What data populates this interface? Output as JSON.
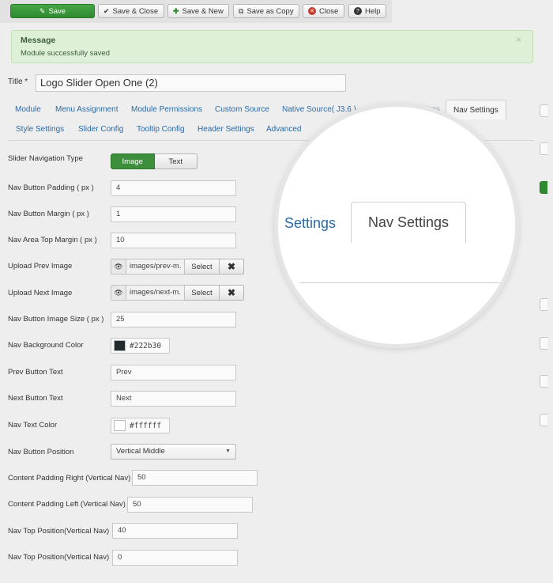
{
  "toolbar": {
    "save": "Save",
    "save_close": "Save & Close",
    "save_new": "Save & New",
    "save_copy": "Save as Copy",
    "close": "Close",
    "help": "Help"
  },
  "message": {
    "title": "Message",
    "text": "Module successfully saved"
  },
  "title_field": {
    "label": "Title *",
    "value": "Logo Slider Open One (2)"
  },
  "tabs": {
    "row1": [
      "Module",
      "Menu Assignment",
      "Module Permissions",
      "Custom Source",
      "Native Source( J3.6 )",
      "Responsive Settings",
      "Nav Settings"
    ],
    "row2": [
      "Style Settings",
      "Slider Config",
      "Tooltip Config",
      "Header Settings",
      "Advanced"
    ]
  },
  "magnifier": {
    "tab_left": "Settings",
    "tab_active": "Nav Settings"
  },
  "form": {
    "nav_type": {
      "label": "Slider Navigation Type",
      "option_on": "Image",
      "option_off": "Text"
    },
    "btn_padding": {
      "label": "Nav Button Padding ( px )",
      "value": "4"
    },
    "btn_margin": {
      "label": "Nav Button Margin ( px )",
      "value": "1"
    },
    "area_top_margin": {
      "label": "Nav Area Top Margin ( px )",
      "value": "10"
    },
    "upload_prev": {
      "label": "Upload Prev Image",
      "path": "images/prev-m.",
      "select": "Select"
    },
    "upload_next": {
      "label": "Upload Next Image",
      "path": "images/next-m.",
      "select": "Select"
    },
    "btn_image_size": {
      "label": "Nav Button Image Size ( px )",
      "value": "25"
    },
    "bg_color": {
      "label": "Nav Background Color",
      "value": "#222b30"
    },
    "prev_text": {
      "label": "Prev Button Text",
      "value": "Prev"
    },
    "next_text": {
      "label": "Next Button Text",
      "value": "Next"
    },
    "text_color": {
      "label": "Nav Text Color",
      "value": "#ffffff"
    },
    "btn_position": {
      "label": "Nav Button Position",
      "value": "Vertical Middle"
    },
    "pad_right": {
      "label": "Content Padding Right (Vertical Nav)",
      "value": "50"
    },
    "pad_left": {
      "label": "Content Padding Left (Vertical Nav)",
      "value": "50"
    },
    "top_pos_1": {
      "label": "Nav Top Position(Vertical Nav)",
      "value": "40"
    },
    "top_pos_2": {
      "label": "Nav Top Position(Vertical Nav)",
      "value": "0"
    }
  },
  "colors": {
    "primary_green": "#3d8f3d",
    "link_blue": "#2a6aa8",
    "nav_bg_swatch": "#222b30",
    "text_swatch": "#ffffff"
  }
}
